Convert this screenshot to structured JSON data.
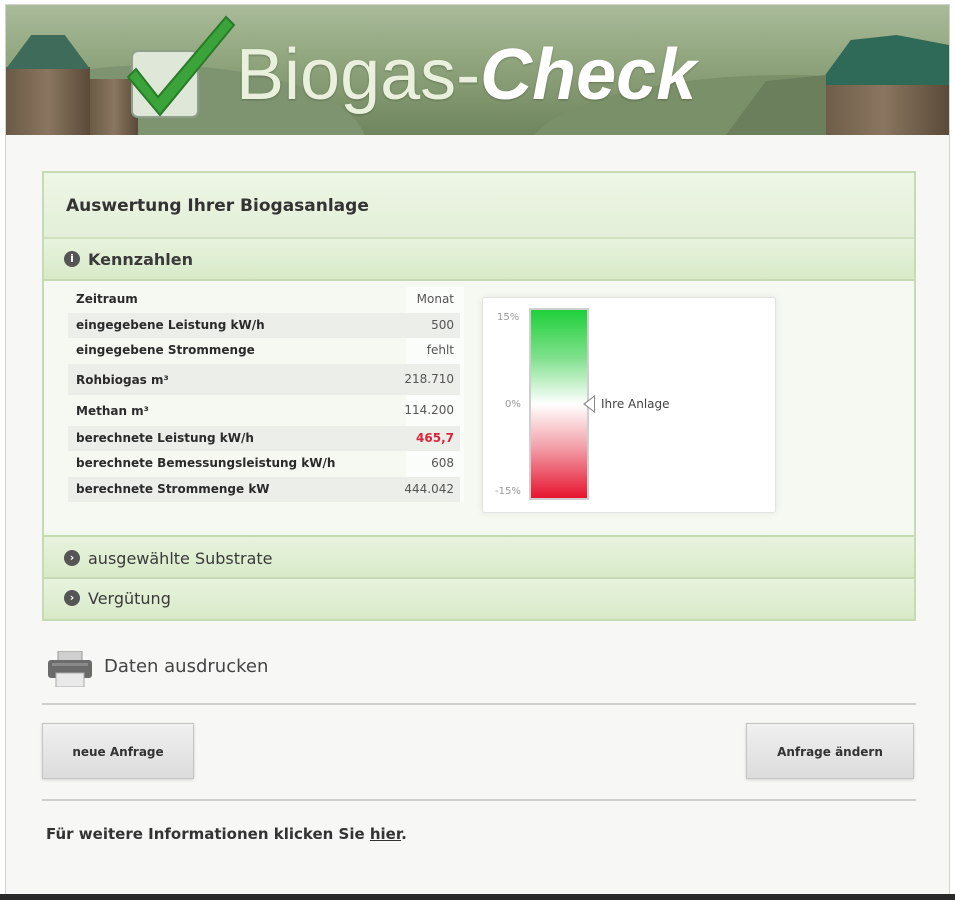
{
  "header": {
    "logo_light": "Biogas-",
    "logo_bold": "Check"
  },
  "panel": {
    "title": "Auswertung Ihrer Biogasanlage",
    "sections": {
      "kennzahlen": "Kennzahlen",
      "substrate": "ausgewählte Substrate",
      "verguetung": "Vergütung"
    },
    "table": [
      {
        "label": "Zeitraum",
        "value": "Monat"
      },
      {
        "label": "eingegebene Leistung kW/h",
        "value": "500"
      },
      {
        "label": "eingegebene Strommenge",
        "value": "fehlt"
      },
      {
        "label": "Rohbiogas m³",
        "value": "218.710"
      },
      {
        "label": "Methan m³",
        "value": "114.200"
      },
      {
        "label": "berechnete Leistung kW/h",
        "value": "465,7"
      },
      {
        "label": "berechnete Bemessungsleistung kW/h",
        "value": "608"
      },
      {
        "label": "berechnete Strommenge kW",
        "value": "444.042"
      }
    ],
    "gauge": {
      "top_tick": "15%",
      "mid_tick": "0%",
      "bottom_tick": "-15%",
      "pointer_label": "Ihre Anlage",
      "pointer_value_percent": 0,
      "colors": {
        "positive": "#1fd03a",
        "neutral": "#ffffff",
        "negative": "#e6142f"
      }
    }
  },
  "actions": {
    "print_label": "Daten ausdrucken",
    "new_request": "neue Anfrage",
    "change_request": "Anfrage ändern"
  },
  "footer": {
    "text_before": "Für weitere Informationen klicken Sie ",
    "link": "hier",
    "text_after": "."
  },
  "colors": {
    "accent_red": "#d9243a",
    "panel_green": "#d8eac8"
  }
}
